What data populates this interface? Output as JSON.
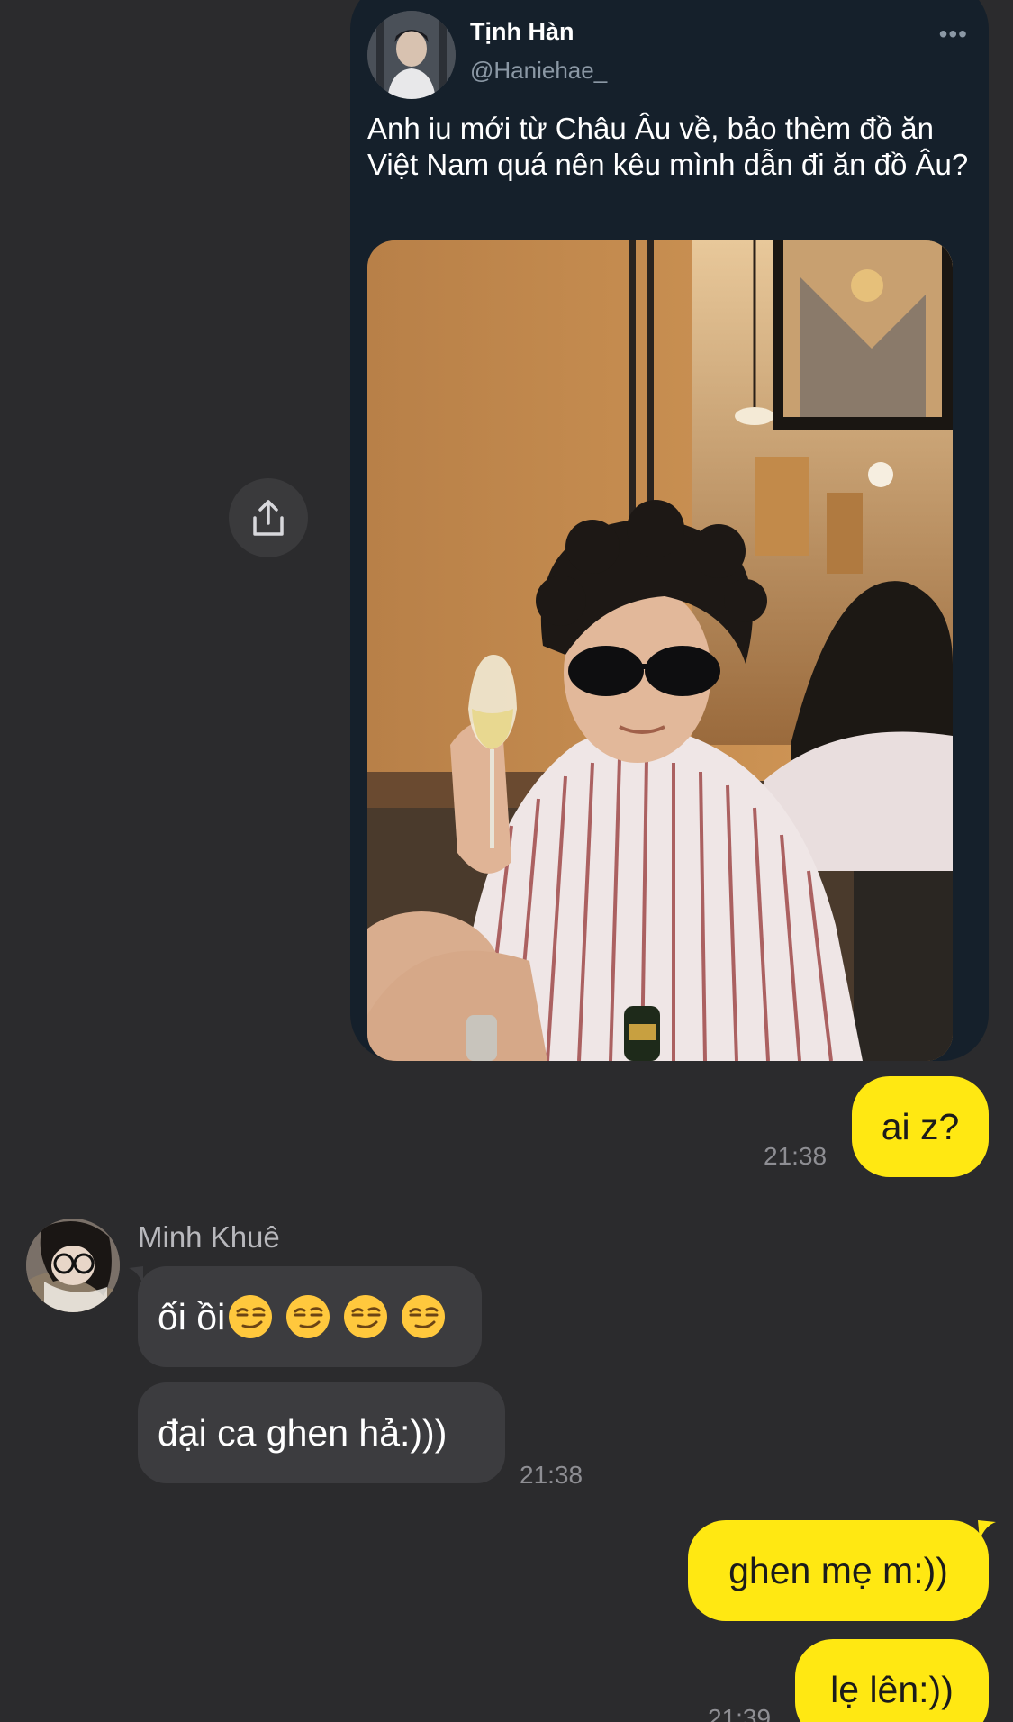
{
  "tweet": {
    "author_name": "Tịnh Hàn",
    "author_handle": "@Haniehae_",
    "more_icon": "more-dots-icon",
    "text": "Anh iu mới từ Châu Âu về, bảo thèm đồ ăn Việt Nam quá nên kêu mình dẫn đi ăn đồ Âu?"
  },
  "share": {
    "icon": "share-upload-icon"
  },
  "messages": {
    "outgoing_1": {
      "text": "ai z?",
      "time": "21:38"
    },
    "incoming_sender": "Minh Khuê",
    "incoming_1": {
      "text": "ối ồi",
      "emoji": "smirk-face-icon"
    },
    "incoming_2": {
      "text": "đại ca ghen hả:)))",
      "time": "21:38"
    },
    "outgoing_2": {
      "text": "ghen mẹ m:))"
    },
    "outgoing_3": {
      "text": "lẹ lên:))",
      "time": "21:39"
    }
  },
  "colors": {
    "background": "#2b2b2d",
    "outgoing_bubble": "#ffe812",
    "incoming_bubble": "#3c3c3f",
    "tweet_card": "#15202b"
  }
}
